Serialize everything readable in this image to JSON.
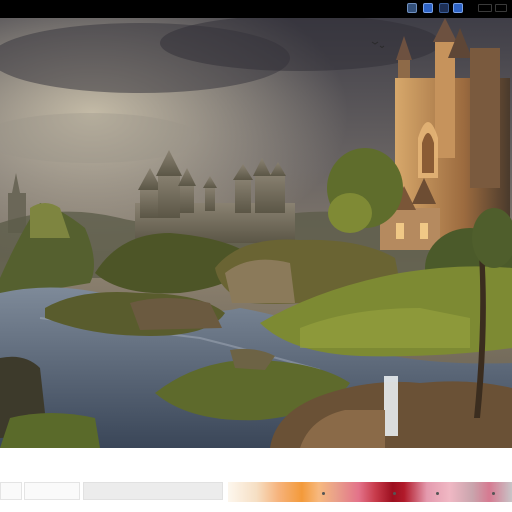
{
  "topbar": {
    "icons": [
      "window-icon",
      "window-icon-active",
      "window-icon-dark",
      "window-icon-active",
      "minimize-icon",
      "maximize-icon"
    ]
  },
  "canvas": {
    "subject": "fantasy-castle-landscape"
  },
  "bottom_panel": {
    "status_text": "",
    "small_label": "",
    "gradient_colors": [
      "#fdf7ee",
      "#f39a3a",
      "#e3738a",
      "#9c0f1f",
      "#e49aae",
      "#c9a5ad",
      "#c8c5c8"
    ]
  }
}
